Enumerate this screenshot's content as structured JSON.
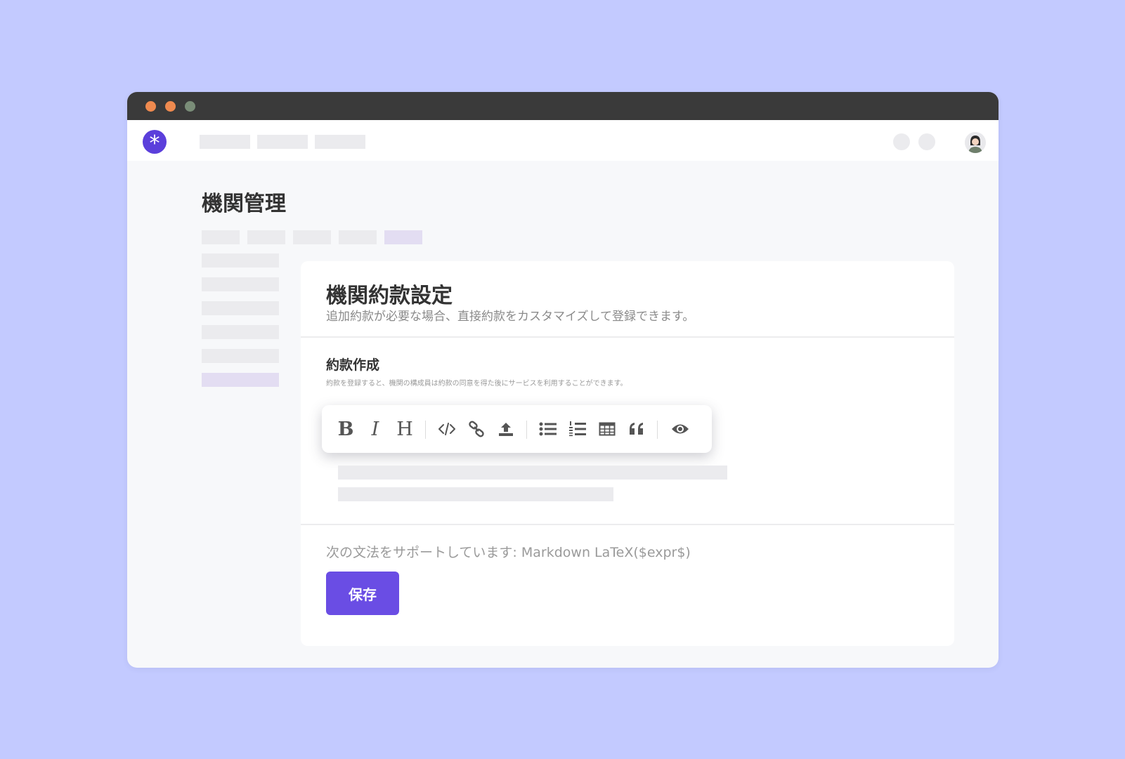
{
  "colors": {
    "background": "#c3caff",
    "titlebar": "#3a3a3a",
    "accent": "#6a4de4",
    "logo": "#5b3fdb",
    "placeholder": "#ebebee",
    "placeholder_active": "#e3ddf2"
  },
  "window": {
    "traffic_lights": [
      "close",
      "minimize",
      "maximize"
    ]
  },
  "header": {
    "logo_glyph": "*",
    "logo_icon": "asterisk-logo-icon",
    "avatar_icon": "user-avatar-icon"
  },
  "page": {
    "title": "機関管理"
  },
  "card": {
    "title": "機関約款設定",
    "description": "追加約款が必要な場合、直接約款をカスタマイズして登録できます。",
    "section_title": "約款作成",
    "section_hint": "約款を登録すると、機関の構成員は約款の同意を得た後にサービスを利用することができます。",
    "syntax_note": "次の文法をサポートしています: Markdown LaTeX($expr$)",
    "save_label": "保存"
  },
  "toolbar": {
    "bold_glyph": "B",
    "italic_glyph": "I",
    "heading_glyph": "H",
    "buttons": [
      "bold-icon",
      "italic-icon",
      "heading-icon",
      "code-icon",
      "link-icon",
      "upload-icon",
      "bulleted-list-icon",
      "numbered-list-icon",
      "table-icon",
      "quote-icon",
      "preview-eye-icon"
    ]
  }
}
